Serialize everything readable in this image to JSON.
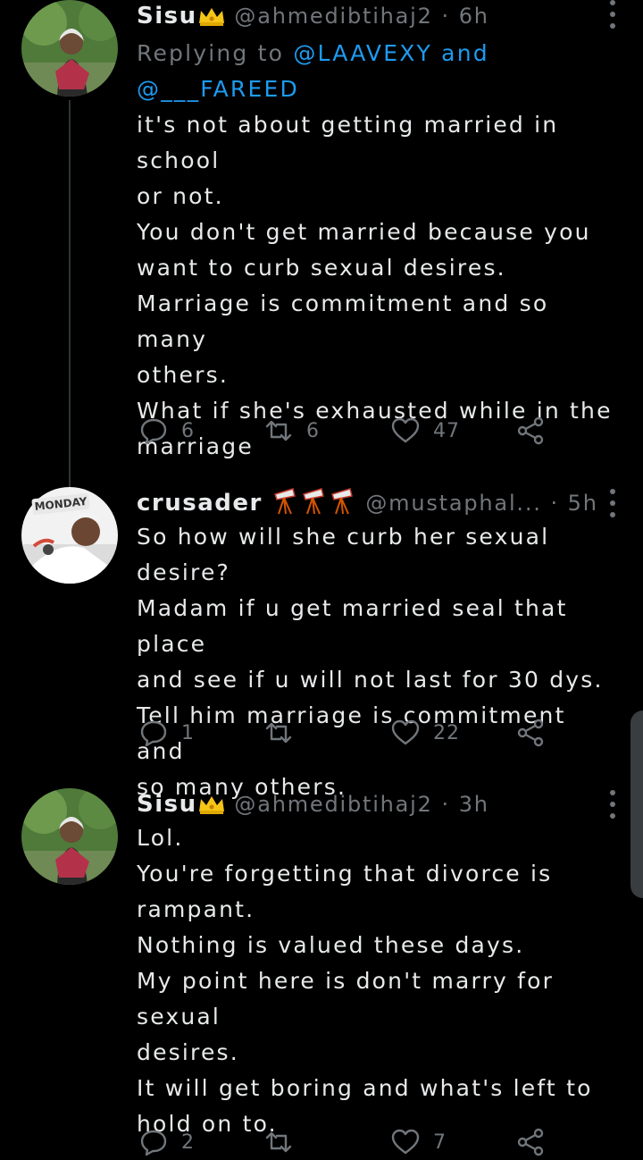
{
  "tweets": [
    {
      "name": "Sisu",
      "handle": "@ahmedibtihaj2",
      "time": "6h",
      "reply_prefix": "Replying to",
      "reply_mention_1": "@LAAVEXY",
      "reply_and": "and",
      "reply_mention_2": "@___FAREED",
      "text": "it's not about getting married in school\nor not.\nYou don't get married because you\nwant to curb sexual desires.\nMarriage is commitment and so many\nothers.\nWhat if she's exhausted while in the\nmarriage",
      "replies": "6",
      "retweets": "6",
      "likes": "47"
    },
    {
      "name": "crusader",
      "handle": "@mustaphal...",
      "time": "5h",
      "badge": "MONDAY",
      "text": "So how will she curb her sexual desire?\nMadam if u get married seal that place\nand see if u will not last for 30 dys.\nTell him marriage is commitment and\nso many others.",
      "replies": "1",
      "retweets": "",
      "likes": "22"
    },
    {
      "name": "Sisu",
      "handle": "@ahmedibtihaj2",
      "time": "3h",
      "text": "Lol.\nYou're forgetting that divorce is\nrampant.\nNothing is valued these days.\nMy point here is don't marry for sexual\ndesires.\nIt will get boring and what's left to\nhold on to.",
      "replies": "2",
      "retweets": "",
      "likes": "7"
    }
  ],
  "separator": "·",
  "colors": {
    "background": "#000000",
    "text": "#e7e9ea",
    "secondary": "#71767b",
    "accent": "#1d9bf0",
    "crown": "#f5c518"
  },
  "icons": [
    "reply-icon",
    "retweet-icon",
    "like-icon",
    "share-icon",
    "more-icon",
    "crown-icon",
    "telescope-icon"
  ]
}
